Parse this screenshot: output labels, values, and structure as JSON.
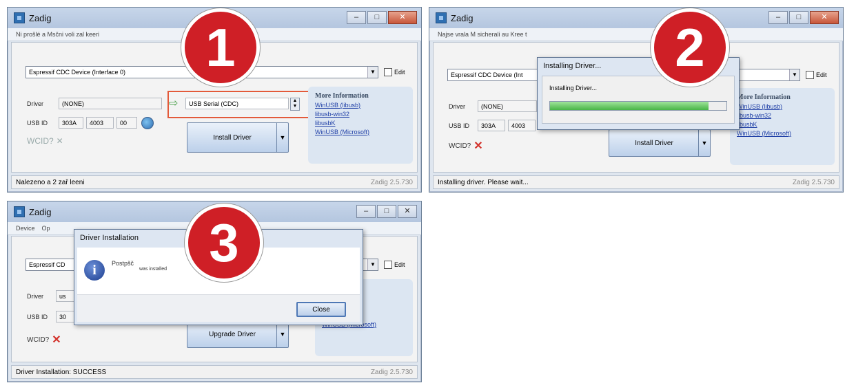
{
  "step1": {
    "number": "1",
    "title": "Zadig",
    "menu_text": "Ni prošlé a Msčni voli zal keeri",
    "device": "Espressif CDC Device (Interface 0)",
    "edit_label": "Edit",
    "driver_label": "Driver",
    "driver_value": "(NONE)",
    "target_driver": "USB Serial (CDC)",
    "usbid_label": "USB ID",
    "usbid_vid": "303A",
    "usbid_pid": "4003",
    "usbid_mi": "00",
    "wcid_label": "WCID?",
    "wcid_mark": "✕",
    "install_button": "Install Driver",
    "info_header": "More Information",
    "links": [
      "WinUSB (libusb)",
      "libusb-win32",
      "libusbK",
      "WinUSB (Microsoft)"
    ],
    "status": "Nalezeno a 2 zař leeni",
    "version": "Zadig 2.5.730"
  },
  "step2": {
    "number": "2",
    "title": "Zadig",
    "menu_text": "Najse vrala M sicherali au Kree t",
    "device": "Espressif CDC Device (Int",
    "edit_label": "Edit",
    "driver_label": "Driver",
    "driver_value": "(NONE)",
    "usbid_label": "USB ID",
    "usbid_vid": "303A",
    "usbid_pid": "4003",
    "wcid_label": "WCID?",
    "wcid_mark": "✕",
    "install_button": "Install Driver",
    "dialog_title": "Installing Driver...",
    "dialog_text": "Installing Driver...",
    "progress": 0.9,
    "info_header": "More Information",
    "links": [
      "WinUSB (libusb)",
      "libusb-win32",
      "libusbK",
      "WinUSB (Microsoft)"
    ],
    "status": "Installing driver. Please wait...",
    "version": "Zadig 2.5.730"
  },
  "step3": {
    "number": "3",
    "title": "Zadig",
    "menu": [
      "Device",
      "Op"
    ],
    "device": "Espressif CD",
    "edit_label": "Edit",
    "driver_label": "Driver",
    "driver_value": "us",
    "usbid_label": "USB ID",
    "usbid_vid": "30",
    "wcid_label": "WCID?",
    "wcid_mark": "✕",
    "upgrade_button": "Upgrade Driver",
    "dialog_title": "Driver Installation",
    "dialog_text": "Postpšč",
    "dialog_text2": "was installed",
    "close_button": "Close",
    "info_header": "rmation",
    "links": [
      "busb)",
      "32",
      "libusbK",
      "WinUSB (Microsoft)"
    ],
    "status": "Driver Installation: SUCCESS",
    "version": "Zadig 2.5.730"
  },
  "icons": {
    "info": "i",
    "arrow": "⇨",
    "dropdown": "▼"
  },
  "colors": {
    "badge": "#cf1f26",
    "highlight": "#e35a3a",
    "link": "#1f3fa6"
  }
}
